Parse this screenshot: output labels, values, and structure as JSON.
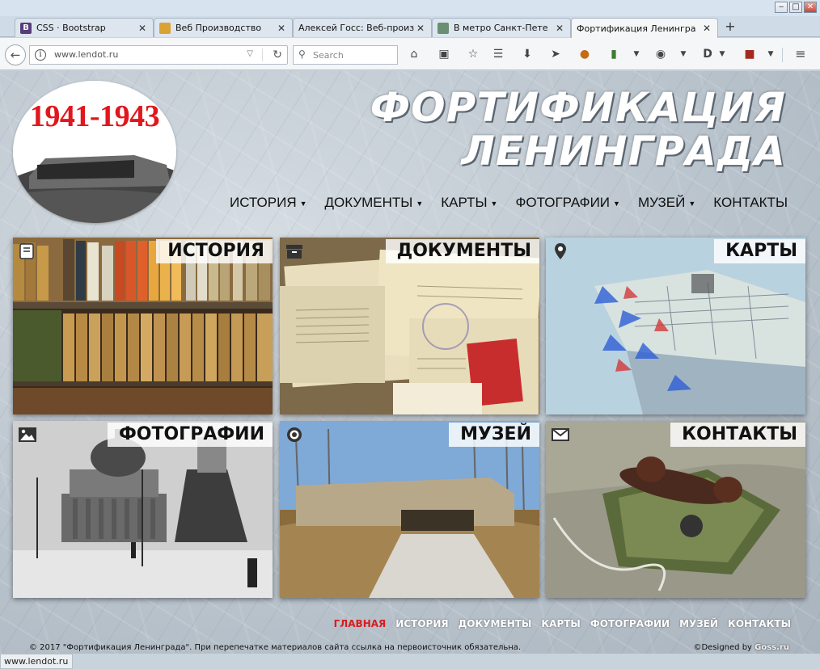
{
  "browser": {
    "tabs": [
      {
        "label": "CSS · Bootstrap",
        "favicon": "B",
        "favicon_color": "#563d7c"
      },
      {
        "label": "Веб Производство",
        "favicon": "",
        "favicon_color": "#d9a233"
      },
      {
        "label": "Алексей Госс: Веб-произ",
        "favicon": "",
        "favicon_color": ""
      },
      {
        "label": "В метро Санкт-Пете",
        "favicon": "",
        "favicon_color": "#6b8f72"
      },
      {
        "label": "Фортификация Ленингра",
        "favicon": "",
        "favicon_color": ""
      }
    ],
    "close_glyph": "✕",
    "new_tab": "+",
    "url": "www.lendot.ru",
    "search_placeholder": "Search",
    "status_url": "www.lendot.ru"
  },
  "site": {
    "logo_years": "1941-1943",
    "title_line1": "ФОРТИФИКАЦИЯ",
    "title_line2": "ЛЕНИНГРАДА",
    "nav": [
      {
        "label": "ИСТОРИЯ",
        "dropdown": true
      },
      {
        "label": "ДОКУМЕНТЫ",
        "dropdown": true
      },
      {
        "label": "КАРТЫ",
        "dropdown": true
      },
      {
        "label": "ФОТОГРАФИИ",
        "dropdown": true
      },
      {
        "label": "МУЗЕЙ",
        "dropdown": true
      },
      {
        "label": "КОНТАКТЫ",
        "dropdown": false
      }
    ],
    "tiles": [
      {
        "label": "ИСТОРИЯ",
        "icon": "book-icon"
      },
      {
        "label": "ДОКУМЕНТЫ",
        "icon": "archive-icon"
      },
      {
        "label": "КАРТЫ",
        "icon": "map-pin-icon"
      },
      {
        "label": "ФОТОГРАФИИ",
        "icon": "image-icon"
      },
      {
        "label": "МУЗЕЙ",
        "icon": "target-icon"
      },
      {
        "label": "КОНТАКТЫ",
        "icon": "envelope-icon"
      }
    ],
    "footer_nav": [
      "ГЛАВНАЯ",
      "ИСТОРИЯ",
      "ДОКУМЕНТЫ",
      "КАРТЫ",
      "ФОТОГРАФИИ",
      "МУЗЕЙ",
      "КОНТАКТЫ"
    ],
    "copyright": "© 2017 \"Фортификация Ленинграда\". При перепечатке материалов сайта ссылка на первоисточник обязательна.",
    "designed_by": "©Designed by",
    "designer": "Goss.ru",
    "accent_color": "#d61f1f"
  }
}
